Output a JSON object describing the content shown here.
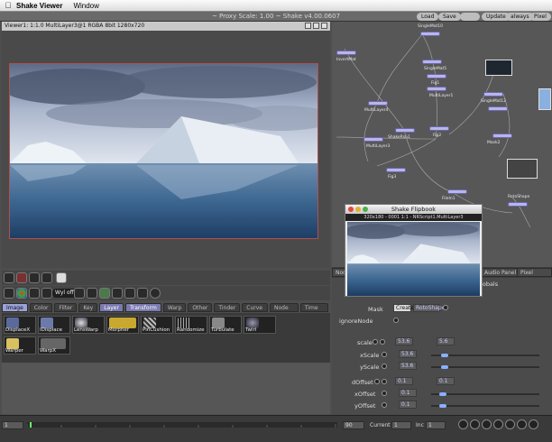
{
  "menubar": {
    "app": "Shake Viewer",
    "menus": [
      "Window"
    ]
  },
  "window": {
    "title": "~ Proxy Scale: 1.00 ~ Shake v4.00.0607"
  },
  "header_buttons": {
    "load": "Load",
    "save": "Save",
    "update": "Update",
    "always": "always",
    "pixel_analyzer": "Pixel"
  },
  "viewer": {
    "header": "Viewer1: 1:1.0 MultiLayer3@1 RGBA 8bit 1280x720",
    "toolbar_pill": "Wyl off"
  },
  "tabs": [
    "Image",
    "Color",
    "Filter",
    "Key",
    "Layer",
    "Transform",
    "Warp",
    "Other",
    "Tinder",
    "Curve Ed",
    "Node View",
    "Time View"
  ],
  "active_tab": "Layer",
  "warp_tools": [
    {
      "label": "DisplaceX",
      "icon": "displace-icon"
    },
    {
      "label": "IDisplace",
      "icon": "idisplace-icon"
    },
    {
      "label": "LensWarp",
      "icon": "lens-icon"
    },
    {
      "label": "Morpher",
      "icon": "morpher-icon"
    },
    {
      "label": "PinCushion",
      "icon": "pincushion-icon"
    },
    {
      "label": "Randomize",
      "icon": "randomize-icon"
    },
    {
      "label": "Turbulate",
      "icon": "turbulate-icon"
    },
    {
      "label": "Twirl",
      "icon": "twirl-icon"
    },
    {
      "label": "Warper",
      "icon": "warper-icon"
    },
    {
      "label": "WarpX",
      "icon": "warpx-icon"
    }
  ],
  "graph_nodes": [
    "SingleMat10",
    "InvertMat",
    "SingleMat5",
    "MultiLayer4",
    "Fig1",
    "MultiLayer1",
    "Fig2",
    "Fig3",
    "SingleMat12",
    "ShakeRsn1",
    "MultiLayer3",
    "Mask2",
    "FileIn1",
    "RotoShape"
  ],
  "graph_tabs": {
    "node": "Node",
    "audio": "Audio Panel",
    "pixel": "Pixel Analyz"
  },
  "flipbook": {
    "title": "Shake Flipbook",
    "info": "320x180 - 0001 1:1 - NRScript1.MultiLayer3"
  },
  "params": {
    "globals": "Globals",
    "mask_label": "Mask",
    "create_btn": "Create",
    "mask_node": "RotoShape",
    "ignore_node": "ignoreNode",
    "rows": [
      {
        "label": "xScale",
        "value": "53.6",
        "knob": 0.1
      },
      {
        "label": "yScale",
        "value": "53.6",
        "knob": 0.1
      },
      {
        "label": "xOffset",
        "value": "0.1",
        "knob": 0.08
      },
      {
        "label": "yOffset",
        "value": "0.1",
        "knob": 0.08
      }
    ],
    "scale_row": {
      "label": "scale",
      "value": "53.6",
      "second": "5.6"
    },
    "offset_row": {
      "label": "dOffset",
      "value": "0.1",
      "second": "0.1"
    }
  },
  "timeline": {
    "start": "1",
    "end": "90",
    "current_label": "Current",
    "current": "1",
    "inc_label": "Inc",
    "inc": "1"
  }
}
